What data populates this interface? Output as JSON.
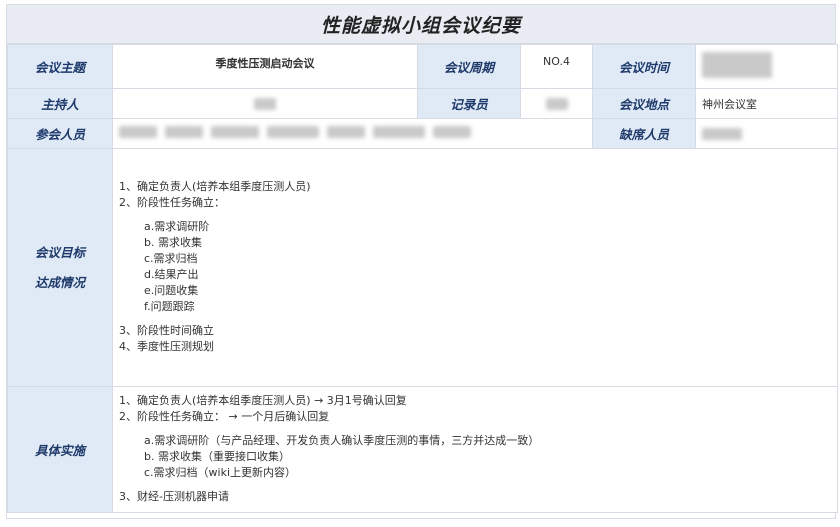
{
  "title": "性能虚拟小组会议纪要",
  "row1": {
    "topic_label": "会议主题",
    "topic_value": "季度性压测启动会议",
    "cycle_label": "会议周期",
    "cycle_value": "NO.4",
    "time_label": "会议时间"
  },
  "row2": {
    "host_label": "主持人",
    "recorder_label": "记录员",
    "location_label": "会议地点",
    "location_value": "神州会议室"
  },
  "row3": {
    "attendees_label": "参会人员",
    "absent_label": "缺席人员"
  },
  "goals": {
    "label_line1": "会议目标",
    "label_line2": "达成情况",
    "items": [
      "1、确定负责人(培养本组季度压测人员)",
      "2、阶段性任务确立："
    ],
    "subitems": [
      "a.需求调研阶",
      "b. 需求收集",
      "c.需求归档",
      "d.结果产出",
      "e.问题收集",
      "f.问题跟踪"
    ],
    "items_after": [
      "3、阶段性时间确立",
      "4、季度性压测规划"
    ]
  },
  "implementation": {
    "label": "具体实施",
    "items": [
      "1、确定负责人(培养本组季度压测人员) → 3月1号确认回复",
      "2、阶段性任务确立： → 一个月后确认回复"
    ],
    "subitems": [
      "a.需求调研阶（与产品经理、开发负责人确认季度压测的事情，三方并达成一致）",
      "b. 需求收集（重要接口收集）",
      "c.需求归档（wiki上更新内容）"
    ],
    "items_after": [
      "3、财经-压测机器申请"
    ]
  },
  "colors": {
    "label_bg": "#dfeaf6",
    "title_bg": "#e9edf3",
    "border": "#d6dbe3"
  }
}
